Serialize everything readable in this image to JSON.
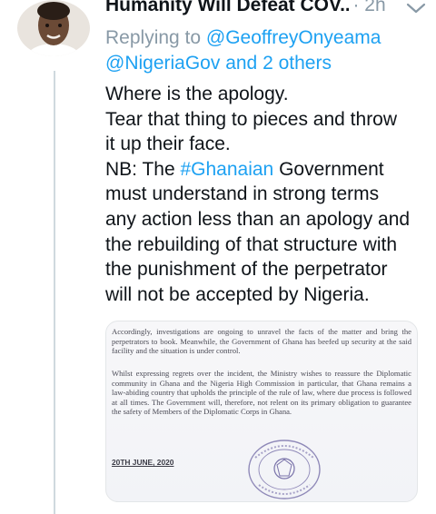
{
  "tweet": {
    "display_name": "Humanity Will Defeat COV...",
    "separator": "·",
    "time": "2h",
    "reply": {
      "prefix": "Replying to",
      "mention_1": "@GeoffreyOnyeama",
      "mention_2": "@NigeriaGov and 2 others"
    },
    "text": {
      "line_1": "Where is the apology.",
      "line_2": "Tear that thing to pieces and throw",
      "line_3": "it up their face.",
      "line_4_prefix": "NB: The ",
      "hashtag": "#Ghanaian",
      "line_4_suffix": " Government",
      "line_5": "must understand in strong terms",
      "line_6": "any action less than an apology and",
      "line_7": "the rebuilding of that structure with",
      "line_8": "the punishment of the perpetrator",
      "line_9": "will not be accepted by Nigeria."
    },
    "media": {
      "para_1": "Accordingly, investigations are ongoing to unravel the facts of the matter and bring the perpetrators to book. Meanwhile, the Government of Ghana has beefed up security at the said facility and the situation is under control.",
      "para_2": "Whilst expressing regrets over the incident, the Ministry wishes to reassure the Diplomatic community in Ghana and the Nigeria High Commission in particular, that Ghana remains a law-abiding country that upholds the principle of the rule of law, where due process is followed at all times. The Government will, therefore, not relent on its primary obligation to guarantee the safety of Members of the Diplomatic Corps in Ghana.",
      "date": "20TH JUNE, 2020",
      "seal_text": "MINISTRY OF FOREIGN AFFAIRS · ACCRA"
    }
  },
  "colors": {
    "link": "#1da1f2",
    "muted": "#8899a6",
    "text": "#0f1419",
    "thread_line": "#cfd9de"
  },
  "icons": {
    "caret": "chevron-down-icon",
    "avatar": "user-avatar"
  }
}
